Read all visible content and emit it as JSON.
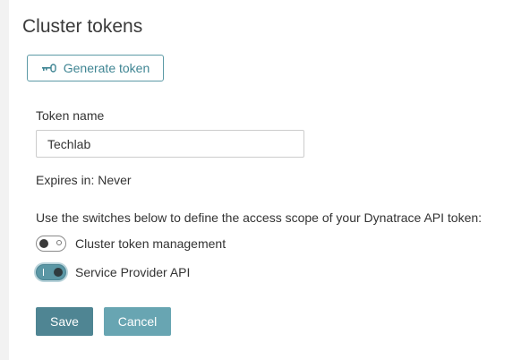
{
  "page": {
    "title": "Cluster tokens"
  },
  "generate_button": {
    "label": "Generate token",
    "icon": "key-icon"
  },
  "form": {
    "token_name_label": "Token name",
    "token_name_value": "Techlab",
    "expires_text": "Expires in: Never",
    "scope_description": "Use the switches below to define the access scope of your Dynatrace API token:",
    "switches": [
      {
        "label": "Cluster token management",
        "on": false
      },
      {
        "label": "Service Provider API",
        "on": true
      }
    ]
  },
  "actions": {
    "save_label": "Save",
    "cancel_label": "Cancel"
  },
  "colors": {
    "accent": "#4f8593",
    "accent_light": "#68a5b2",
    "outline": "#5c9aa6"
  }
}
